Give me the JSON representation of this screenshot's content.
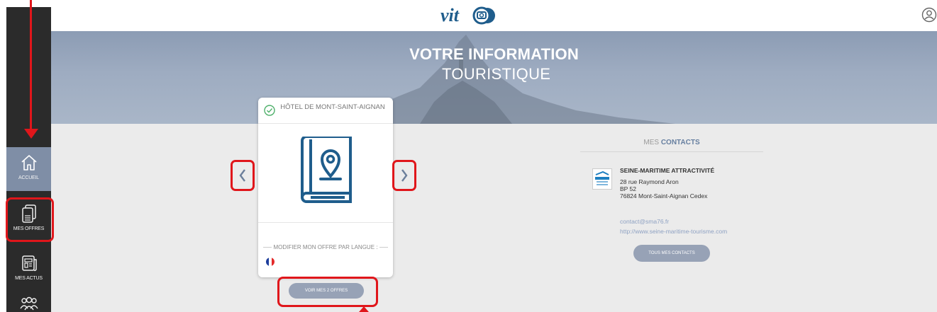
{
  "sidebar": {
    "items": [
      {
        "label": "ACCUEIL",
        "icon": "home-icon",
        "active": true
      },
      {
        "label": "MES OFFRES",
        "icon": "documents-icon"
      },
      {
        "label": "MES ACTUS",
        "icon": "newspaper-icon"
      },
      {
        "label": "",
        "icon": "users-icon"
      }
    ]
  },
  "header": {
    "logo": "vit",
    "user_icon": "user-circle-icon"
  },
  "hero": {
    "title": "VOTRE INFORMATION",
    "subtitle": "TOURISTIQUE"
  },
  "offer_card": {
    "name": "HÔTEL DE MONT-SAINT-AIGNAN",
    "modify_label": "MODIFIER MON OFFRE PAR LANGUE :",
    "languages": [
      "fr"
    ],
    "voir_button": "VOIR MES 2 OFFRES"
  },
  "contacts": {
    "heading_prefix": "MES",
    "heading_bold": "CONTACTS",
    "org_name": "SEINE-MARITIME ATTRACTIVITÉ",
    "address": [
      "28 rue Raymond Aron",
      "BP 52",
      "76824 Mont-Saint-Aignan Cedex"
    ],
    "email": "contact@sma76.fr",
    "website": "http://www.seine-maritime-tourisme.com",
    "all_button": "TOUS MES CONTACTS"
  },
  "colors": {
    "sidebar": "#2b2b2b",
    "active": "#7f8ea6",
    "accent": "#1f5d8c",
    "annotation": "#e0161b"
  }
}
